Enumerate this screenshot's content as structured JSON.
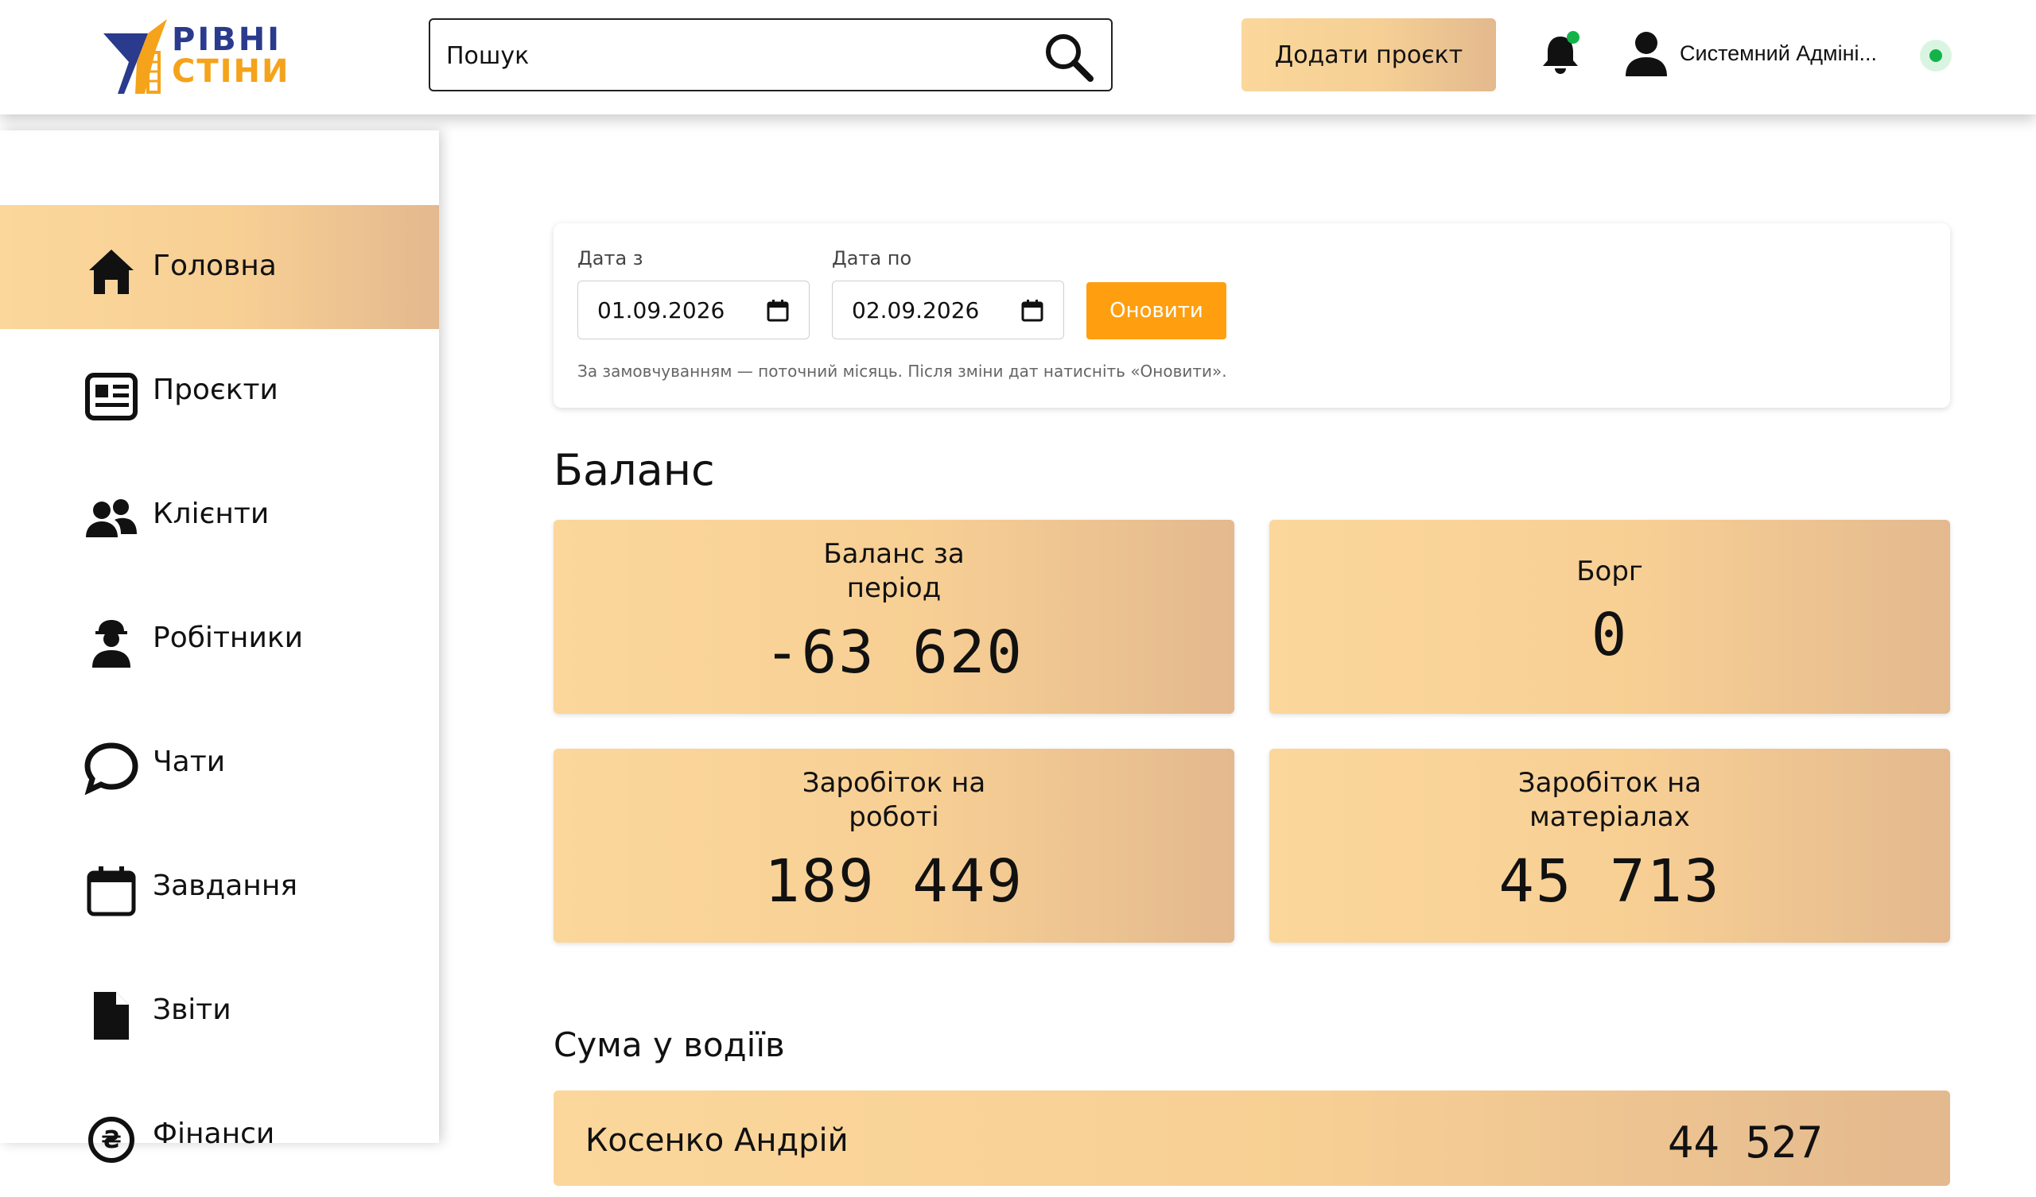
{
  "header": {
    "logo_line1": "РІВНІ",
    "logo_line2": "СТІНИ",
    "search_placeholder": "Пошук",
    "add_project_label": "Додати проєкт",
    "user_name": "Системний Адміні..."
  },
  "sidebar": {
    "items": [
      {
        "label": "Головна",
        "icon": "home-icon",
        "active": true
      },
      {
        "label": "Проєкти",
        "icon": "newspaper-icon"
      },
      {
        "label": "Клієнти",
        "icon": "users-icon"
      },
      {
        "label": "Робітники",
        "icon": "worker-icon"
      },
      {
        "label": "Чати",
        "icon": "chat-icon"
      },
      {
        "label": "Завдання",
        "icon": "calendar-icon"
      },
      {
        "label": "Звіти",
        "icon": "document-icon"
      },
      {
        "label": "Фінанси",
        "icon": "finance-icon"
      }
    ]
  },
  "filter": {
    "date_from_label": "Дата з",
    "date_from_value": "01.09.2026",
    "date_to_label": "Дата по",
    "date_to_value": "02.09.2026",
    "refresh_label": "Оновити",
    "hint": "За замовчуванням — поточний місяць. Після зміни дат натисніть «Оновити»."
  },
  "balance": {
    "title": "Баланс",
    "cards": [
      {
        "label": "Баланс за\nперіод",
        "value": "-63 620"
      },
      {
        "label": "Борг",
        "value": "0"
      },
      {
        "label": "Заробіток на\nроботі",
        "value": "189 449"
      },
      {
        "label": "Заробіток на\nматеріалах",
        "value": "45 713"
      }
    ]
  },
  "drivers": {
    "title": "Сума у водіїв",
    "rows": [
      {
        "name": "Косенко Андрій",
        "sum": "44 527"
      }
    ]
  },
  "colors": {
    "accent_orange": "#ff9f0f",
    "card_gradient_start": "#fbd79b",
    "card_gradient_end": "#e3b98e",
    "status_green": "#14b34a",
    "logo_blue": "#2a3a8c",
    "logo_yellow": "#f5a31a"
  }
}
